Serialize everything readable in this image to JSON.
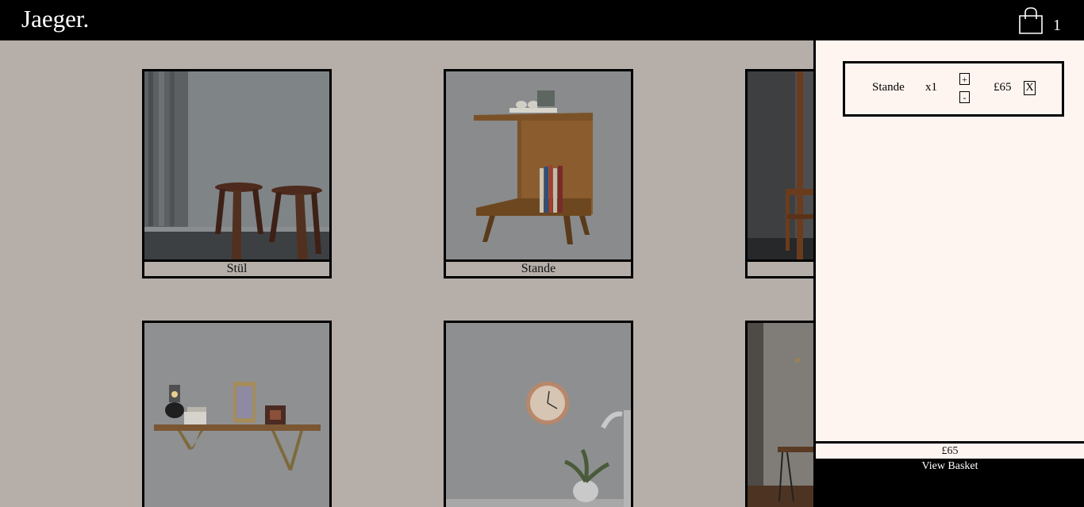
{
  "header": {
    "logo": "Jaeger.",
    "basket_count": "1"
  },
  "products": [
    {
      "name": "Stül"
    },
    {
      "name": "Stande"
    },
    {
      "name": ""
    },
    {
      "name": ""
    },
    {
      "name": ""
    },
    {
      "name": ""
    }
  ],
  "cart": {
    "items": [
      {
        "name": "Stande",
        "qty": "x1",
        "plus": "+",
        "minus": "-",
        "price": "£65",
        "remove": "X"
      }
    ],
    "total": "£65",
    "view_basket": "View Basket"
  },
  "icons": [
    "shopping-bag-icon"
  ],
  "colors": {
    "header": "#000000",
    "page": "#b5aea9",
    "cart_panel": "#fff5f0"
  }
}
